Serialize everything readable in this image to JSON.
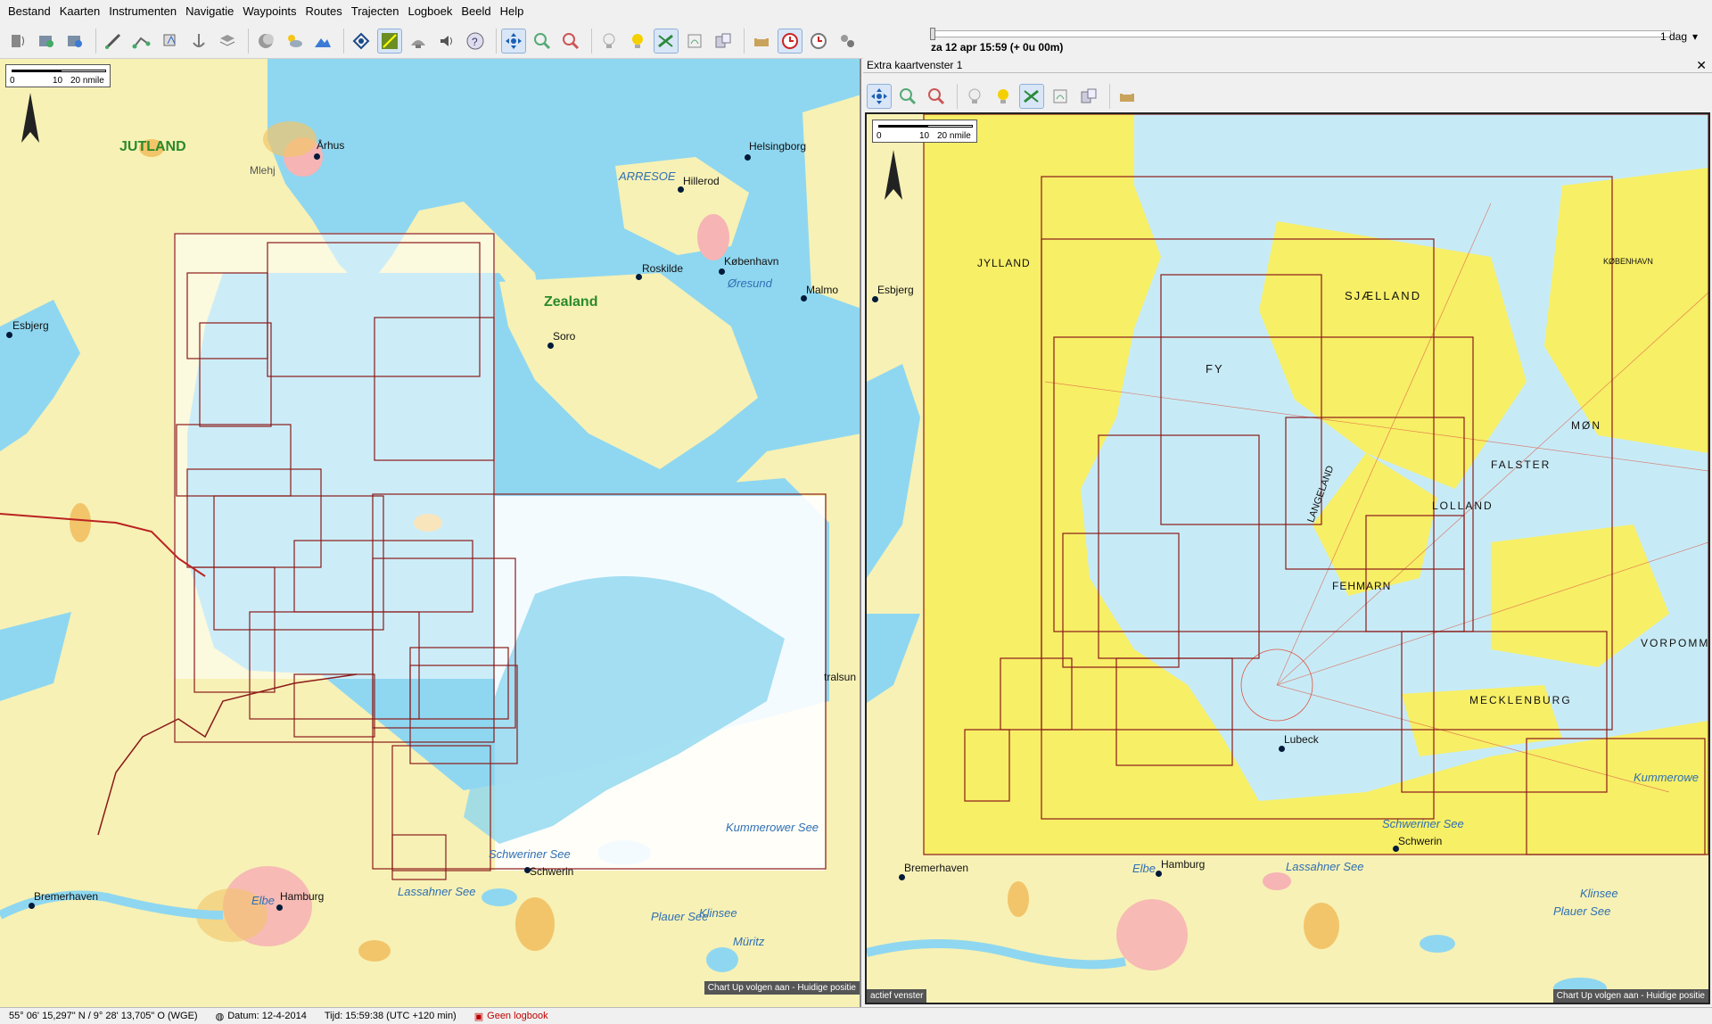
{
  "menu": [
    "Bestand",
    "Kaarten",
    "Instrumenten",
    "Navigatie",
    "Waypoints",
    "Routes",
    "Trajecten",
    "Logboek",
    "Beeld",
    "Help"
  ],
  "toolbar": {
    "icons": [
      "gps-icon",
      "instrument-icon",
      "instrument2-icon",
      "measure-icon",
      "route-icon",
      "waypoint-icon",
      "anchor-icon",
      "chart-icon",
      "moon-icon",
      "weather-icon",
      "terrain-icon",
      "layers-icon",
      "track-icon",
      "grid-icon",
      "brightness-icon",
      "sound-icon",
      "help-icon",
      "pan-icon",
      "zoom-in-icon",
      "zoom-out-icon",
      "light-off-icon",
      "light-on-icon",
      "follow-icon",
      "rotate-icon",
      "windows-icon",
      "print-icon",
      "clock-icon",
      "alarm-icon",
      "settings-icon"
    ]
  },
  "time": {
    "label": "za 12 apr 15:59  (+ 0u 00m)",
    "duration": "1 dag"
  },
  "left_map": {
    "scale": {
      "s0": "0",
      "s10": "10",
      "s20": "20 nmile"
    },
    "labels": {
      "aarhus": "Århus",
      "jutland": "JUTLAND",
      "mlehj": "Mlehj",
      "helsingborg": "Helsingborg",
      "arresoe": "ARRESOE",
      "hillerod": "Hillerod",
      "roskilde": "Roskilde",
      "kobenhavn": "København",
      "oresund": "Øresund",
      "malmo": "Malmo",
      "zealand": "Zealand",
      "soro": "Soro",
      "esbjerg": "Esbjerg",
      "stralsund": "tralsun",
      "kummerower": "Kummerower See",
      "schweriner": "Schweriner See",
      "schwerin": "Schwerin",
      "bremerhaven": "Bremerhaven",
      "hamburg": "Hamburg",
      "elbe": "Elbe",
      "lassahner": "Lassahner See",
      "plauer": "Plauer See",
      "kiinsee": "Klinsee",
      "muritz": "Müritz"
    },
    "status": "Chart Up volgen aan - Huidige positie"
  },
  "extra": {
    "title": "Extra kaartvenster 1",
    "close": "✕",
    "scale": {
      "s0": "0",
      "s10": "10",
      "s20": "20 nmile"
    },
    "labels": {
      "jylland": "JYLLAND",
      "sjaelland": "SJÆLLAND",
      "fyn": "FY",
      "esbjerg": "Esbjerg",
      "lolland": "LOLLAND",
      "falster": "FALSTER",
      "mon": "MØN",
      "fehmarn": "FEHMARN",
      "mecklenburg": "MECKLENBURG",
      "vorpommern": "VORPOMM",
      "lubeck": "Lubeck",
      "hamburg": "Hamburg",
      "bremerhaven": "Bremerhaven",
      "schwerin": "Schwerin",
      "schweriner": "Schweriner See",
      "lassahner": "Lassahner See",
      "elbe": "Elbe",
      "kummerower": "Kummerowe",
      "langeland": "LANGELAND",
      "kiinsee": "Klinsee",
      "plauer": "Plauer See",
      "kobenhavn": "KØBENHAVN"
    },
    "active": "actief venster",
    "status": "Chart Up volgen aan - Huidige positie"
  },
  "statusbar": {
    "position": "55° 06' 15,297\" N / 9° 28' 13,705\" O (WGE)",
    "date": "Datum: 12-4-2014",
    "time": "Tijd: 15:59:38 (UTC +120 min)",
    "logbook": "Geen logbook"
  },
  "colors": {
    "land": "#f7f1b5",
    "sea": "#8fd7f0",
    "shallow": "#cfeefa",
    "urban": "#f6b4b4",
    "forest": "#f2c56a",
    "chartframe": "#8b1a1a",
    "chartland": "#f7ef66"
  }
}
